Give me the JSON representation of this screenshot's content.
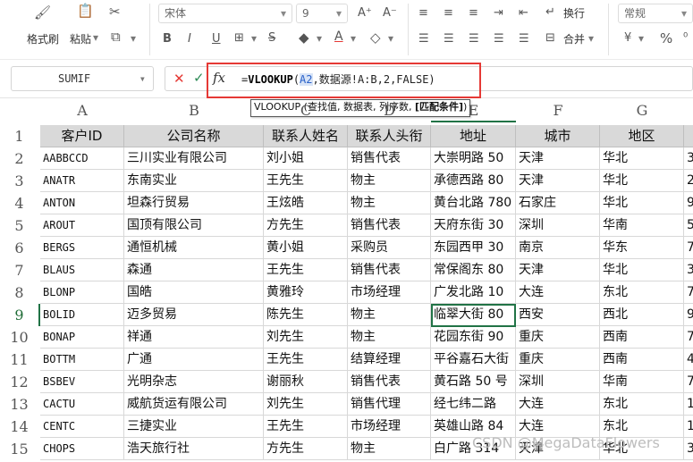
{
  "ribbon": {
    "format_painter": "格式刷",
    "paste": "粘贴",
    "font_name": "宋体",
    "font_size": "9",
    "wrap": "换行",
    "merge": "合并",
    "number_format": "常规",
    "percent": "%"
  },
  "formula_bar": {
    "name_box": "SUMIF",
    "fx": "fx",
    "eq": "=",
    "fn": "VLOOKUP",
    "open": "(",
    "ref": "A2",
    "rest": ",数据源!A:B,2,FALSE)"
  },
  "tooltip": {
    "plain": "VLOOKUP (查找值, 数据表, 列序数, ",
    "bold": "[匹配条件]",
    "close": ")"
  },
  "columns": [
    "A",
    "B",
    "C",
    "D",
    "E",
    "F",
    "G"
  ],
  "header_row": [
    "客户ID",
    "公司名称",
    "联系人姓名",
    "联系人头衔",
    "地址",
    "城市",
    "地区"
  ],
  "rows": [
    [
      "AABBCCD",
      "三川实业有限公司",
      "刘小姐",
      "销售代表",
      "大崇明路 50",
      "天津",
      "华北",
      "3"
    ],
    [
      "ANATR",
      "东南实业",
      "王先生",
      "物主",
      "承德西路 80",
      "天津",
      "华北",
      "2"
    ],
    [
      "ANTON",
      "坦森行贸易",
      "王炫皓",
      "物主",
      "黄台北路 780",
      "石家庄",
      "华北",
      "9"
    ],
    [
      "AROUT",
      "国顶有限公司",
      "方先生",
      "销售代表",
      "天府东街 30",
      "深圳",
      "华南",
      "5"
    ],
    [
      "BERGS",
      "通恒机械",
      "黄小姐",
      "采购员",
      "东园西甲 30",
      "南京",
      "华东",
      "7"
    ],
    [
      "BLAUS",
      "森通",
      "王先生",
      "销售代表",
      "常保阁东 80",
      "天津",
      "华北",
      "3"
    ],
    [
      "BLONP",
      "国皓",
      "黄雅玲",
      "市场经理",
      "广发北路 10",
      "大连",
      "东北",
      "7"
    ],
    [
      "BOLID",
      "迈多贸易",
      "陈先生",
      "物主",
      "临翠大街 80",
      "西安",
      "西北",
      "9"
    ],
    [
      "BONAP",
      "祥通",
      "刘先生",
      "物主",
      "花园东街 90",
      "重庆",
      "西南",
      "7"
    ],
    [
      "BOTTM",
      "广通",
      "王先生",
      "结算经理",
      "平谷嘉石大街",
      "重庆",
      "西南",
      "4"
    ],
    [
      "BSBEV",
      "光明杂志",
      "谢丽秋",
      "销售代表",
      "黄石路 50 号",
      "深圳",
      "华南",
      "7"
    ],
    [
      "CACTU",
      "威航货运有限公司",
      "刘先生",
      "销售代理",
      "经七纬二路",
      "大连",
      "东北",
      "1"
    ],
    [
      "CENTC",
      "三捷实业",
      "王先生",
      "市场经理",
      "英雄山路 84",
      "大连",
      "东北",
      "1"
    ],
    [
      "CHOPS",
      "浩天旅行社",
      "方先生",
      "物主",
      "白广路 314",
      "天津",
      "华北",
      "3"
    ]
  ],
  "active_row": "9",
  "watermark": "CSDN @MegaDataFlowers"
}
